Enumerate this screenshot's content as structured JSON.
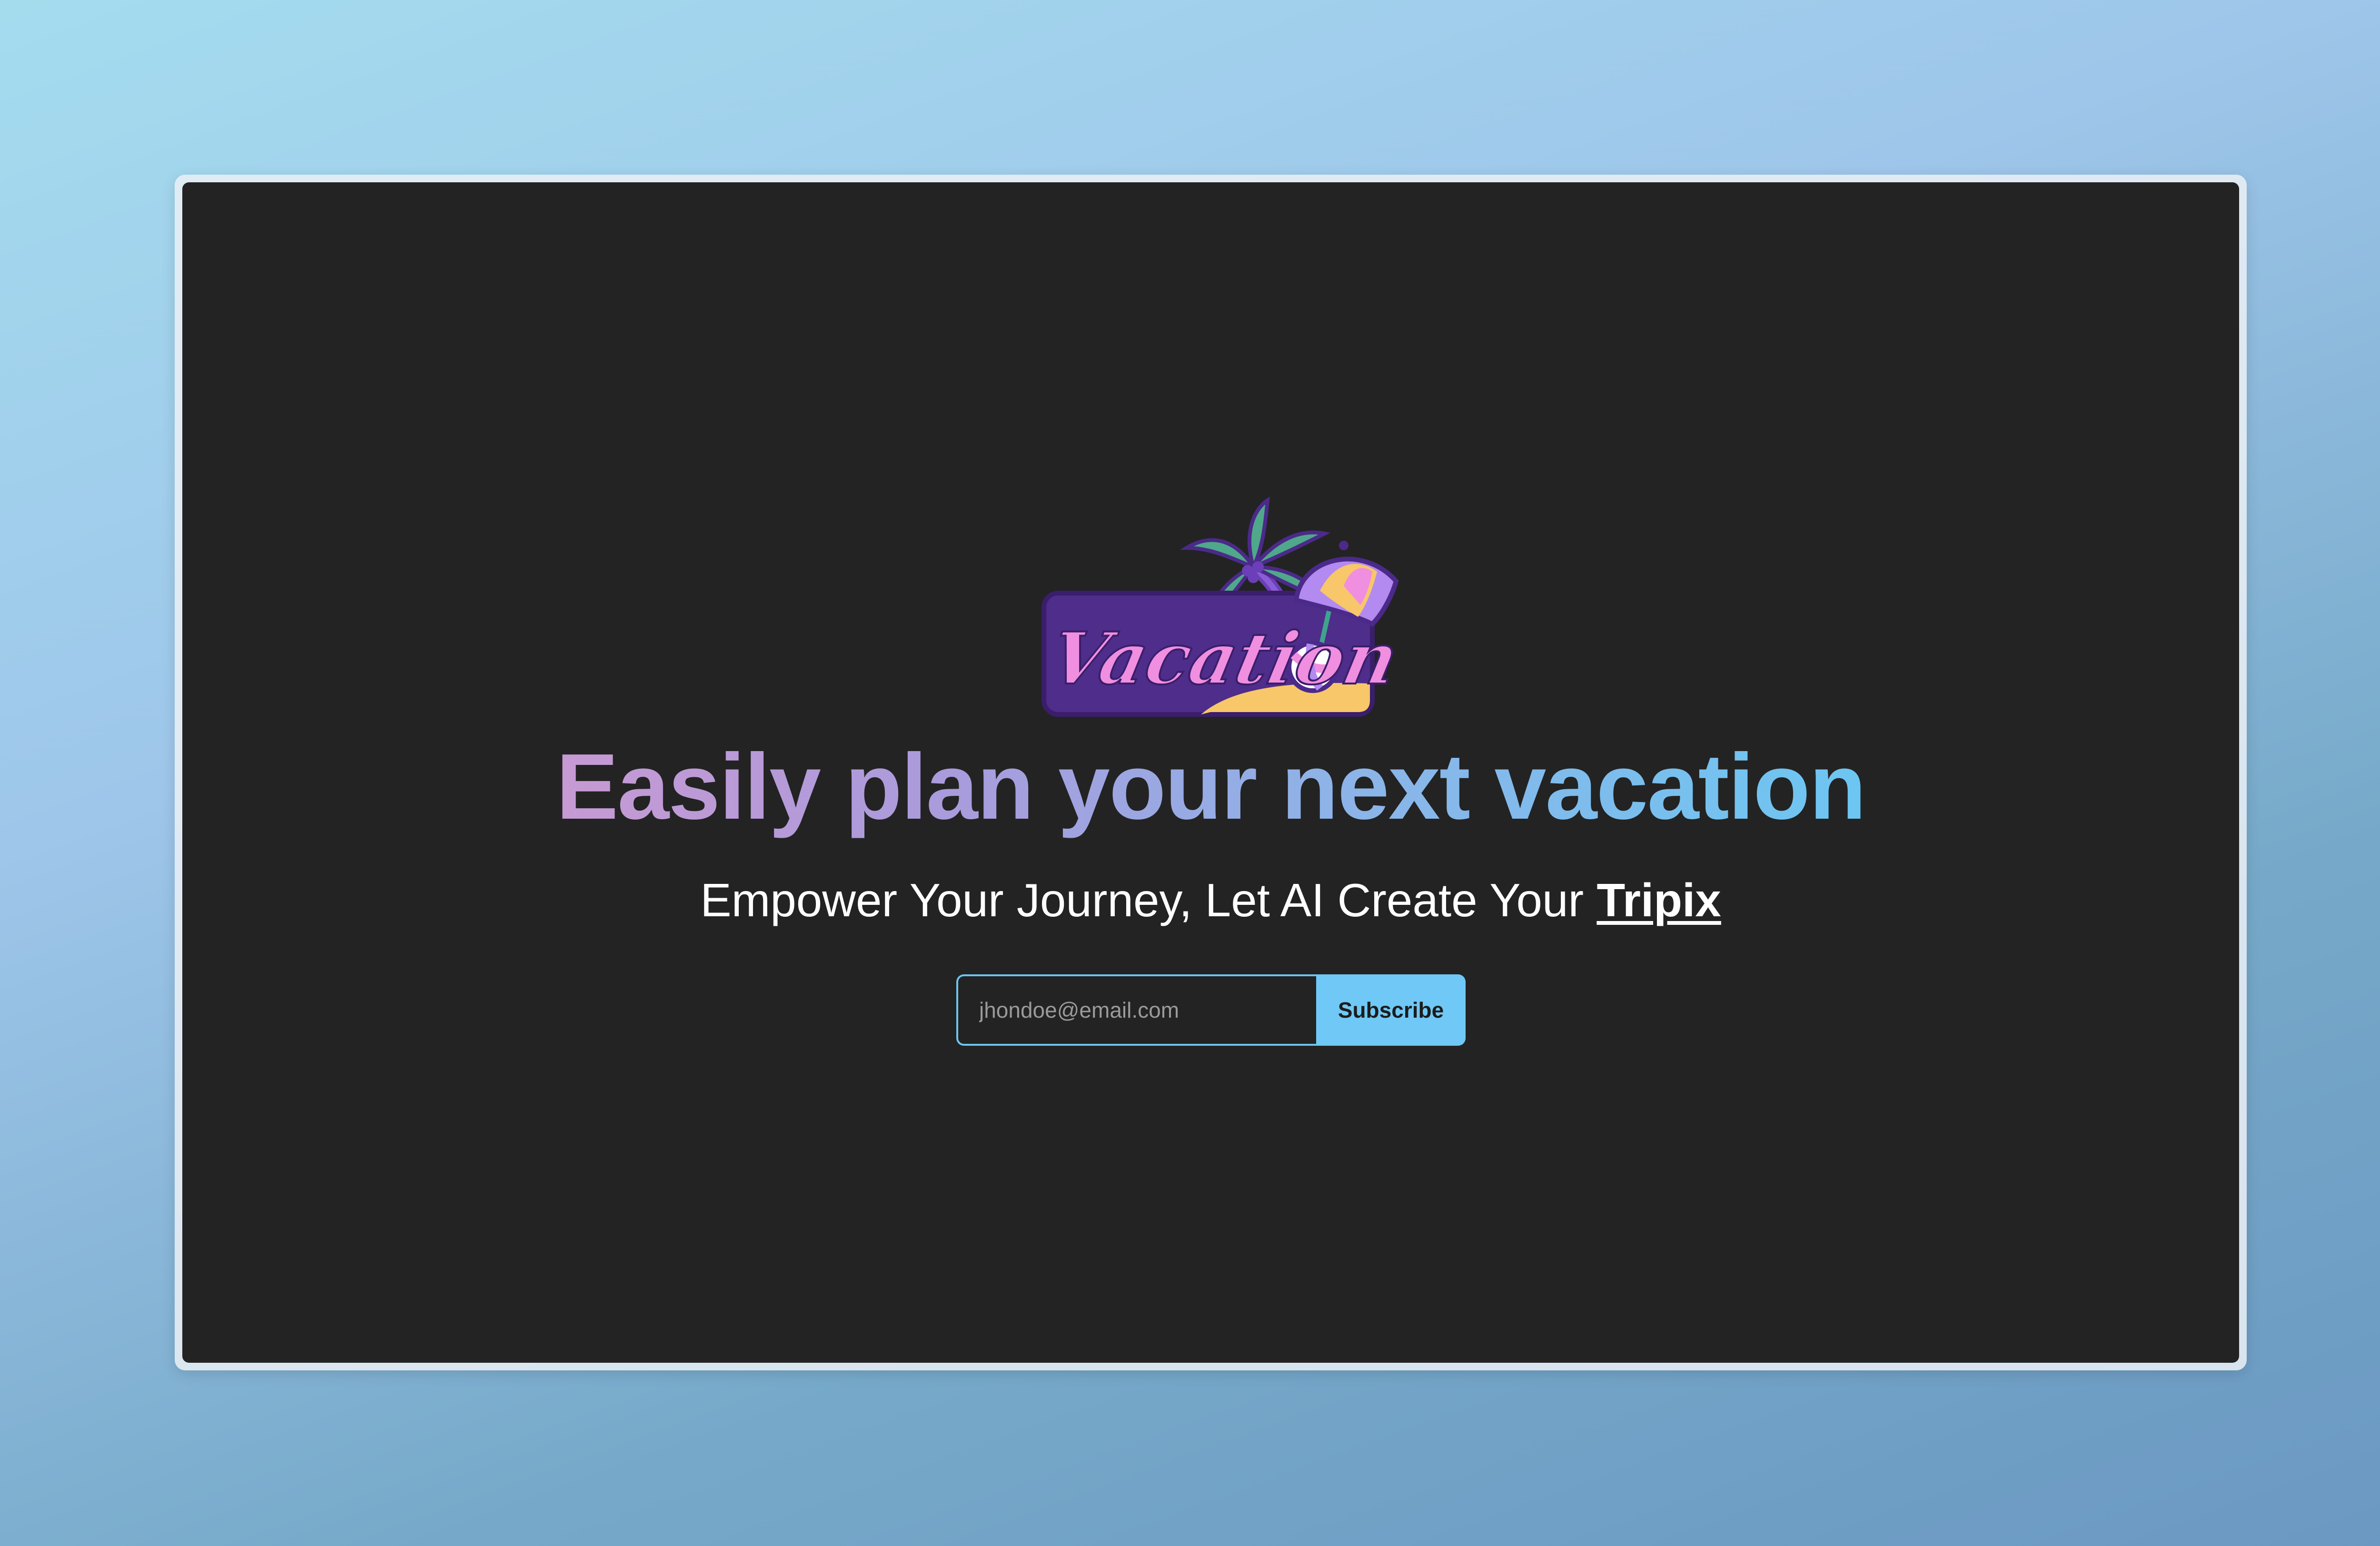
{
  "hero": {
    "logo_text": "Vacation",
    "headline": "Easily plan your next vacation",
    "subtitle_prefix": "Empower Your Journey, Let AI Create Your ",
    "subtitle_brand": "Tripix"
  },
  "subscribe_form": {
    "email_placeholder": "jhondoe@email.com",
    "email_value": "",
    "button_label": "Subscribe"
  },
  "colors": {
    "window_background": "#232323",
    "accent": "#6fc8f5",
    "headline_gradient_start": "#c79ad3",
    "headline_gradient_end": "#6cc6f2",
    "logo_badge": "#4f2d8a",
    "logo_script": "#f08ee0"
  },
  "icons": {
    "logo": "vacation-logo-icon",
    "palm_tree": "palm-tree-icon",
    "umbrella": "beach-umbrella-icon",
    "ball": "beach-ball-icon"
  }
}
